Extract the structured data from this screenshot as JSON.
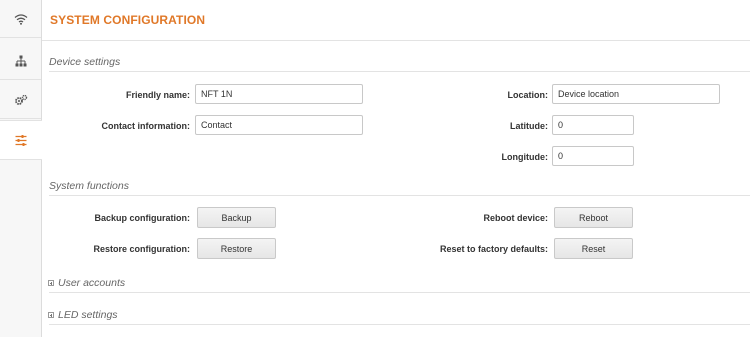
{
  "sidebar": {
    "items": [
      {
        "icon": "wifi-icon"
      },
      {
        "icon": "network-topology-icon"
      },
      {
        "icon": "gears-icon"
      },
      {
        "icon": "sliders-icon",
        "active": true
      }
    ],
    "accent_color": "#e07828"
  },
  "page": {
    "title": "SYSTEM CONFIGURATION"
  },
  "device_settings": {
    "heading": "Device settings",
    "friendly_name_label": "Friendly name:",
    "friendly_name_value": "NFT 1N",
    "contact_label": "Contact information:",
    "contact_value": "Contact",
    "location_label": "Location:",
    "location_value": "Device location",
    "latitude_label": "Latitude:",
    "latitude_value": "0",
    "longitude_label": "Longitude:",
    "longitude_value": "0"
  },
  "system_functions": {
    "heading": "System functions",
    "backup_label": "Backup configuration:",
    "backup_button": "Backup",
    "restore_label": "Restore configuration:",
    "restore_button": "Restore",
    "reboot_label": "Reboot device:",
    "reboot_button": "Reboot",
    "reset_label": "Reset to factory defaults:",
    "reset_button": "Reset"
  },
  "user_accounts": {
    "heading": "User accounts"
  },
  "led_settings": {
    "heading": "LED settings"
  }
}
